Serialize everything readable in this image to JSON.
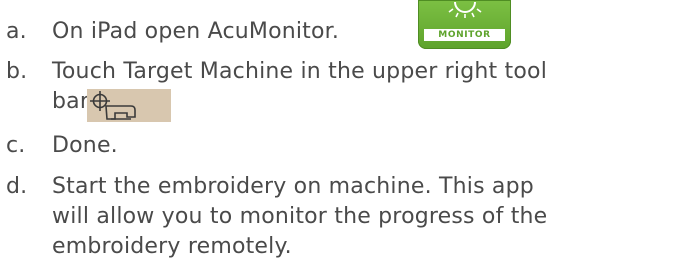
{
  "steps": [
    {
      "marker": "a.",
      "lines": [
        "On iPad open AcuMonitor."
      ],
      "icon": {
        "name": "acumonitor-app-icon",
        "badge_text": "MONITOR",
        "color": "#5ea32c"
      }
    },
    {
      "marker": "b.",
      "lines": [
        "Touch Target Machine in the upper right tool",
        "bar."
      ],
      "icon": {
        "name": "target-machine-icon",
        "color": "#d8c7af"
      }
    },
    {
      "marker": "c.",
      "lines": [
        "Done."
      ]
    },
    {
      "marker": "d.",
      "lines": [
        "Start the embroidery on machine. This app",
        "will allow you to monitor the progress of the",
        "embroidery remotely."
      ]
    }
  ]
}
